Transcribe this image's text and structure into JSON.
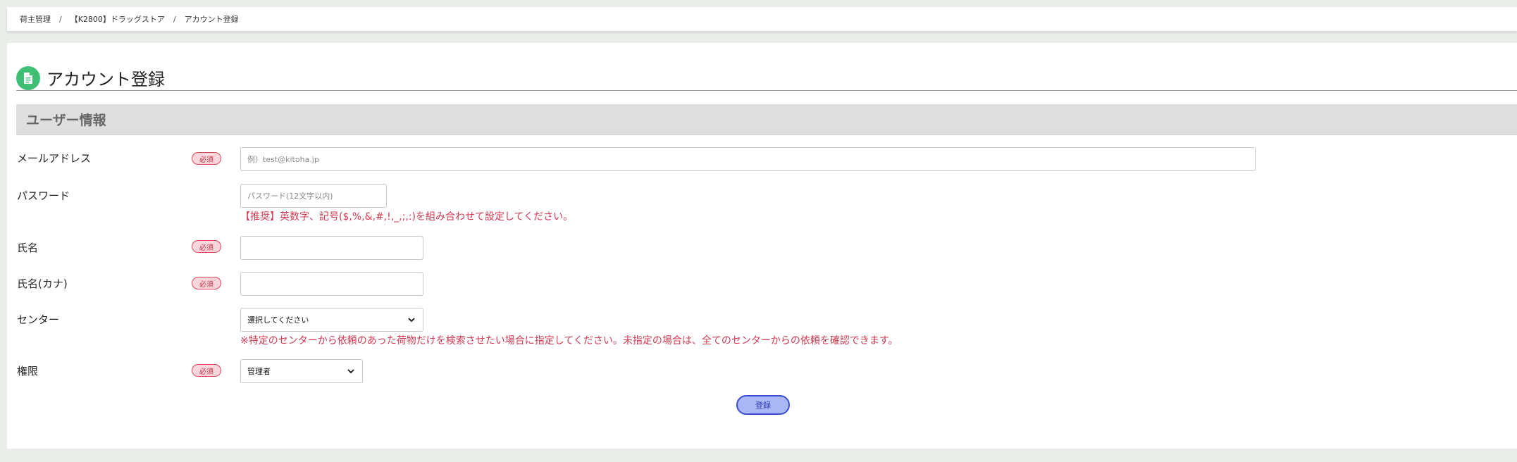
{
  "breadcrumb": {
    "items": [
      "荷主管理",
      "【K2800】ドラッグストア",
      "アカウント登録"
    ],
    "separator": "/"
  },
  "page": {
    "title": "アカウント登録",
    "icon": "document-icon"
  },
  "section": {
    "title": "ユーザー情報"
  },
  "required_label": "必須",
  "fields": {
    "email": {
      "label": "メールアドレス",
      "placeholder": "例）test@kitoha.jp",
      "value": ""
    },
    "password": {
      "label": "パスワード",
      "placeholder": "パスワード(12文字以内)",
      "value": "",
      "hint": "【推奨】英数字、記号($,%,&,#,!,_,;,:)を組み合わせて設定してください。"
    },
    "name": {
      "label": "氏名",
      "value": ""
    },
    "name_kana": {
      "label": "氏名(カナ)",
      "value": ""
    },
    "center": {
      "label": "センター",
      "selected": "選択してください",
      "hint": "※特定のセンターから依頼のあった荷物だけを検索させたい場合に指定してください。未指定の場合は、全てのセンターからの依頼を確認できます。"
    },
    "role": {
      "label": "権限",
      "selected": "管理者"
    }
  },
  "submit_label": "登録",
  "colors": {
    "accent_green": "#3fbf73",
    "required_pink": "#fbd7dd",
    "hint_red": "#d03a52",
    "button_blue": "#aab7f6"
  }
}
